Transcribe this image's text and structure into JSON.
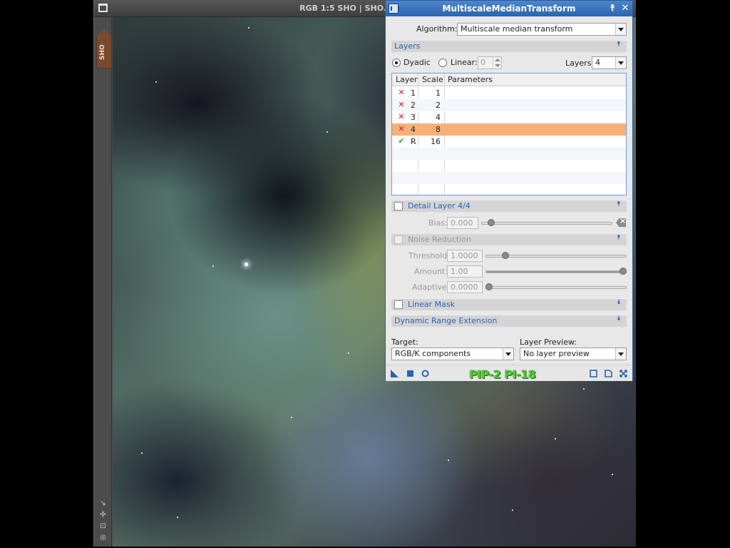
{
  "image_window": {
    "title": "RGB 1:5 SHO | SHO.",
    "identifier_tab": "SHO"
  },
  "dialog": {
    "title": "MultiscaleMedianTransform",
    "titlebar_buttons": {
      "shade": "⯭",
      "close": "✕"
    },
    "algorithm": {
      "label": "Algorithm:",
      "value": "Multiscale median transform"
    },
    "layers_section": {
      "title": "Layers",
      "dyadic_label": "Dyadic",
      "linear_label": "Linear:",
      "linear_value": "0",
      "layers_label": "Layers:",
      "layers_value": "4",
      "selected_mode": "dyadic"
    },
    "layer_table": {
      "columns": [
        "Layer",
        "Scale",
        "Parameters"
      ],
      "rows": [
        {
          "status": "disabled",
          "layer": "1",
          "scale": "1",
          "parameters": ""
        },
        {
          "status": "disabled",
          "layer": "2",
          "scale": "2",
          "parameters": ""
        },
        {
          "status": "disabled",
          "layer": "3",
          "scale": "4",
          "parameters": ""
        },
        {
          "status": "disabled",
          "layer": "4",
          "scale": "8",
          "parameters": "",
          "selected": true
        },
        {
          "status": "enabled",
          "layer": "R",
          "scale": "16",
          "parameters": ""
        }
      ]
    },
    "detail_layer": {
      "title": "Detail Layer 4/4",
      "bias_label": "Bias:",
      "bias_value": "0.000",
      "bias_slider": 0.05
    },
    "noise_reduction": {
      "title": "Noise Reduction",
      "threshold_label": "Threshold:",
      "threshold_value": "1.0000",
      "threshold_slider": 0.12,
      "amount_label": "Amount:",
      "amount_value": "1.00",
      "amount_slider": 1.0,
      "adaptive_label": "Adaptive:",
      "adaptive_value": "0.0000",
      "adaptive_slider": 0.0
    },
    "linear_mask": {
      "title": "Linear Mask"
    },
    "dynamic_range": {
      "title": "Dynamic Range Extension"
    },
    "target": {
      "label": "Target:",
      "value": "RGB/K components"
    },
    "layer_preview": {
      "label": "Layer Preview:",
      "value": "No layer preview"
    },
    "overlay_text": "PIP-2 PI-18",
    "colors": {
      "titlebar": "#2c64ae",
      "section_title": "#2f62b5",
      "selected_row": "#f7b07a",
      "disabled_mark": "#c81e1e",
      "enabled_mark": "#3a9a30",
      "overlay_text": "#58c13c"
    },
    "icons": {
      "disabled_mark": "✕",
      "enabled_mark": "✔",
      "expand": "⯭",
      "collapse": "⯯"
    }
  }
}
